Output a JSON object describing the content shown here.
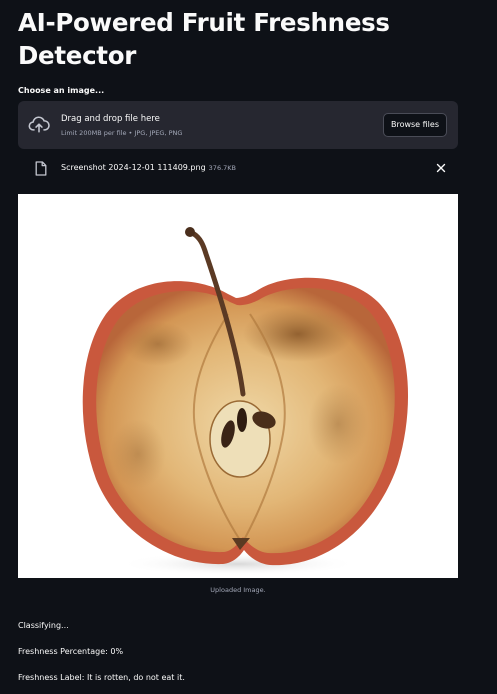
{
  "title": "AI-Powered Fruit Freshness Detector",
  "uploader": {
    "label": "Choose an image...",
    "drop_title": "Drag and drop file here",
    "limit_text": "Limit 200MB per file • JPG, JPEG, PNG",
    "browse_label": "Browse files",
    "icon": "cloud-upload-icon"
  },
  "uploaded_file": {
    "name": "Screenshot 2024-12-01 111409.png",
    "size": "376.7KB",
    "icon": "file-icon",
    "remove_icon": "close-icon"
  },
  "image": {
    "caption": "Uploaded Image."
  },
  "results": {
    "status": "Classifying...",
    "percentage": "Freshness Percentage: 0%",
    "label": "Freshness Label: It is rotten, do not eat it."
  },
  "colors": {
    "background": "#0e1117",
    "panel": "#262730",
    "text": "#fafafa",
    "muted": "#a3a8b8"
  }
}
